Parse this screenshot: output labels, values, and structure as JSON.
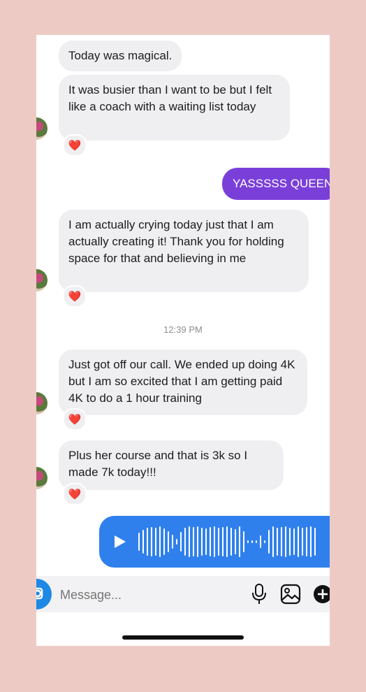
{
  "thread": {
    "msg1": "Today was magical.",
    "msg2": "It was busier than I want to be but I felt like a coach with a waiting list today",
    "sent1": "YASSSSS QUEEN",
    "msg3": "I am actually crying today just that I am actually creating it!  Thank you for holding space for that and believing in me",
    "time": "12:39 PM",
    "msg4": "Just got off our call.  We ended up doing 4K but I am so excited that I am getting paid 4K to do a 1 hour training",
    "msg5": "Plus her course and that is 3k so I made 7k today!!!"
  },
  "reaction": "❤️",
  "composer": {
    "placeholder": "Message..."
  },
  "colors": {
    "background": "#edcbc4",
    "received_bubble": "#efeff1",
    "sent_bubble": "#7a3fd9",
    "voice_bubble": "#2f80ed"
  }
}
